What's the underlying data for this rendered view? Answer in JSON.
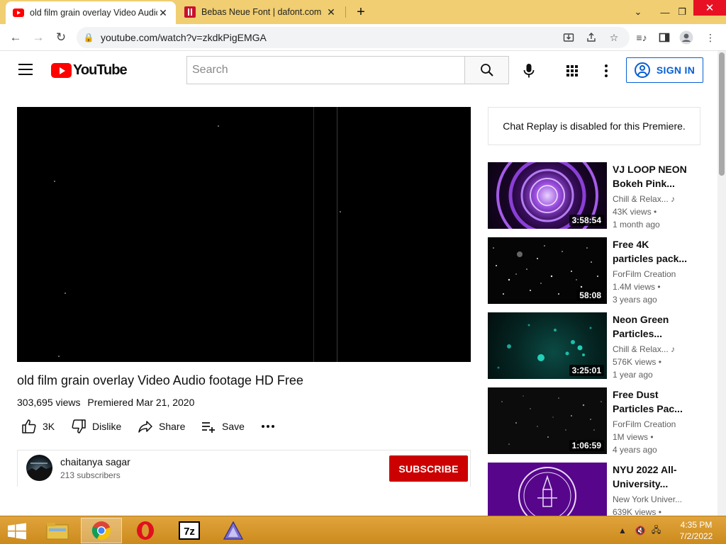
{
  "browser": {
    "tabs": [
      {
        "title": "old film grain overlay Video Audio footage HD Free - YouTube",
        "favicon": "youtube-icon",
        "active": true
      },
      {
        "title": "Bebas Neue Font | dafont.com",
        "favicon": "dafont-icon",
        "active": false
      }
    ],
    "url": "youtube.com/watch?v=zkdkPigEMGA"
  },
  "header": {
    "logo_text": "YouTube",
    "search_placeholder": "Search",
    "signin_label": "SIGN IN"
  },
  "video": {
    "title": "old film grain overlay Video Audio footage HD Free",
    "views": "303,695 views",
    "premiered": "Premiered Mar 21, 2020",
    "like_count": "3K",
    "dislike_label": "Dislike",
    "share_label": "Share",
    "save_label": "Save"
  },
  "channel": {
    "name": "chaitanya sagar",
    "subscribers": "213 subscribers",
    "subscribe_label": "SUBSCRIBE"
  },
  "chat": {
    "message": "Chat Replay is disabled for this Premiere."
  },
  "recommendations": [
    {
      "title_l1": "VJ LOOP NEON",
      "title_l2": "Bokeh Pink...",
      "channel": "Chill & Relax...",
      "views": "43K views •",
      "age": "1 month ago",
      "duration": "3:58:54",
      "music_badge": true
    },
    {
      "title_l1": "Free 4K",
      "title_l2": "particles pack...",
      "channel": "ForFilm Creation",
      "views": "1.4M views •",
      "age": "3 years ago",
      "duration": "58:08",
      "music_badge": false
    },
    {
      "title_l1": "Neon Green",
      "title_l2": "Particles...",
      "channel": "Chill & Relax...",
      "views": "576K views •",
      "age": "1 year ago",
      "duration": "3:25:01",
      "music_badge": true
    },
    {
      "title_l1": "Free Dust",
      "title_l2": "Particles Pac...",
      "channel": "ForFilm Creation",
      "views": "1M views •",
      "age": "4 years ago",
      "duration": "1:06:59",
      "music_badge": false
    },
    {
      "title_l1": "NYU 2022 All-",
      "title_l2": "University...",
      "channel": "New York Univer...",
      "views": "639K views •",
      "age": "",
      "duration": "",
      "music_badge": false
    }
  ],
  "taskbar": {
    "time": "4:35 PM",
    "date": "7/2/2022"
  },
  "colors": {
    "tabstrip": "#f0ce71",
    "yt_red": "#ff0000",
    "subscribe_red": "#cc0000",
    "link_blue": "#065fd4",
    "taskbar": "#d99a30"
  }
}
